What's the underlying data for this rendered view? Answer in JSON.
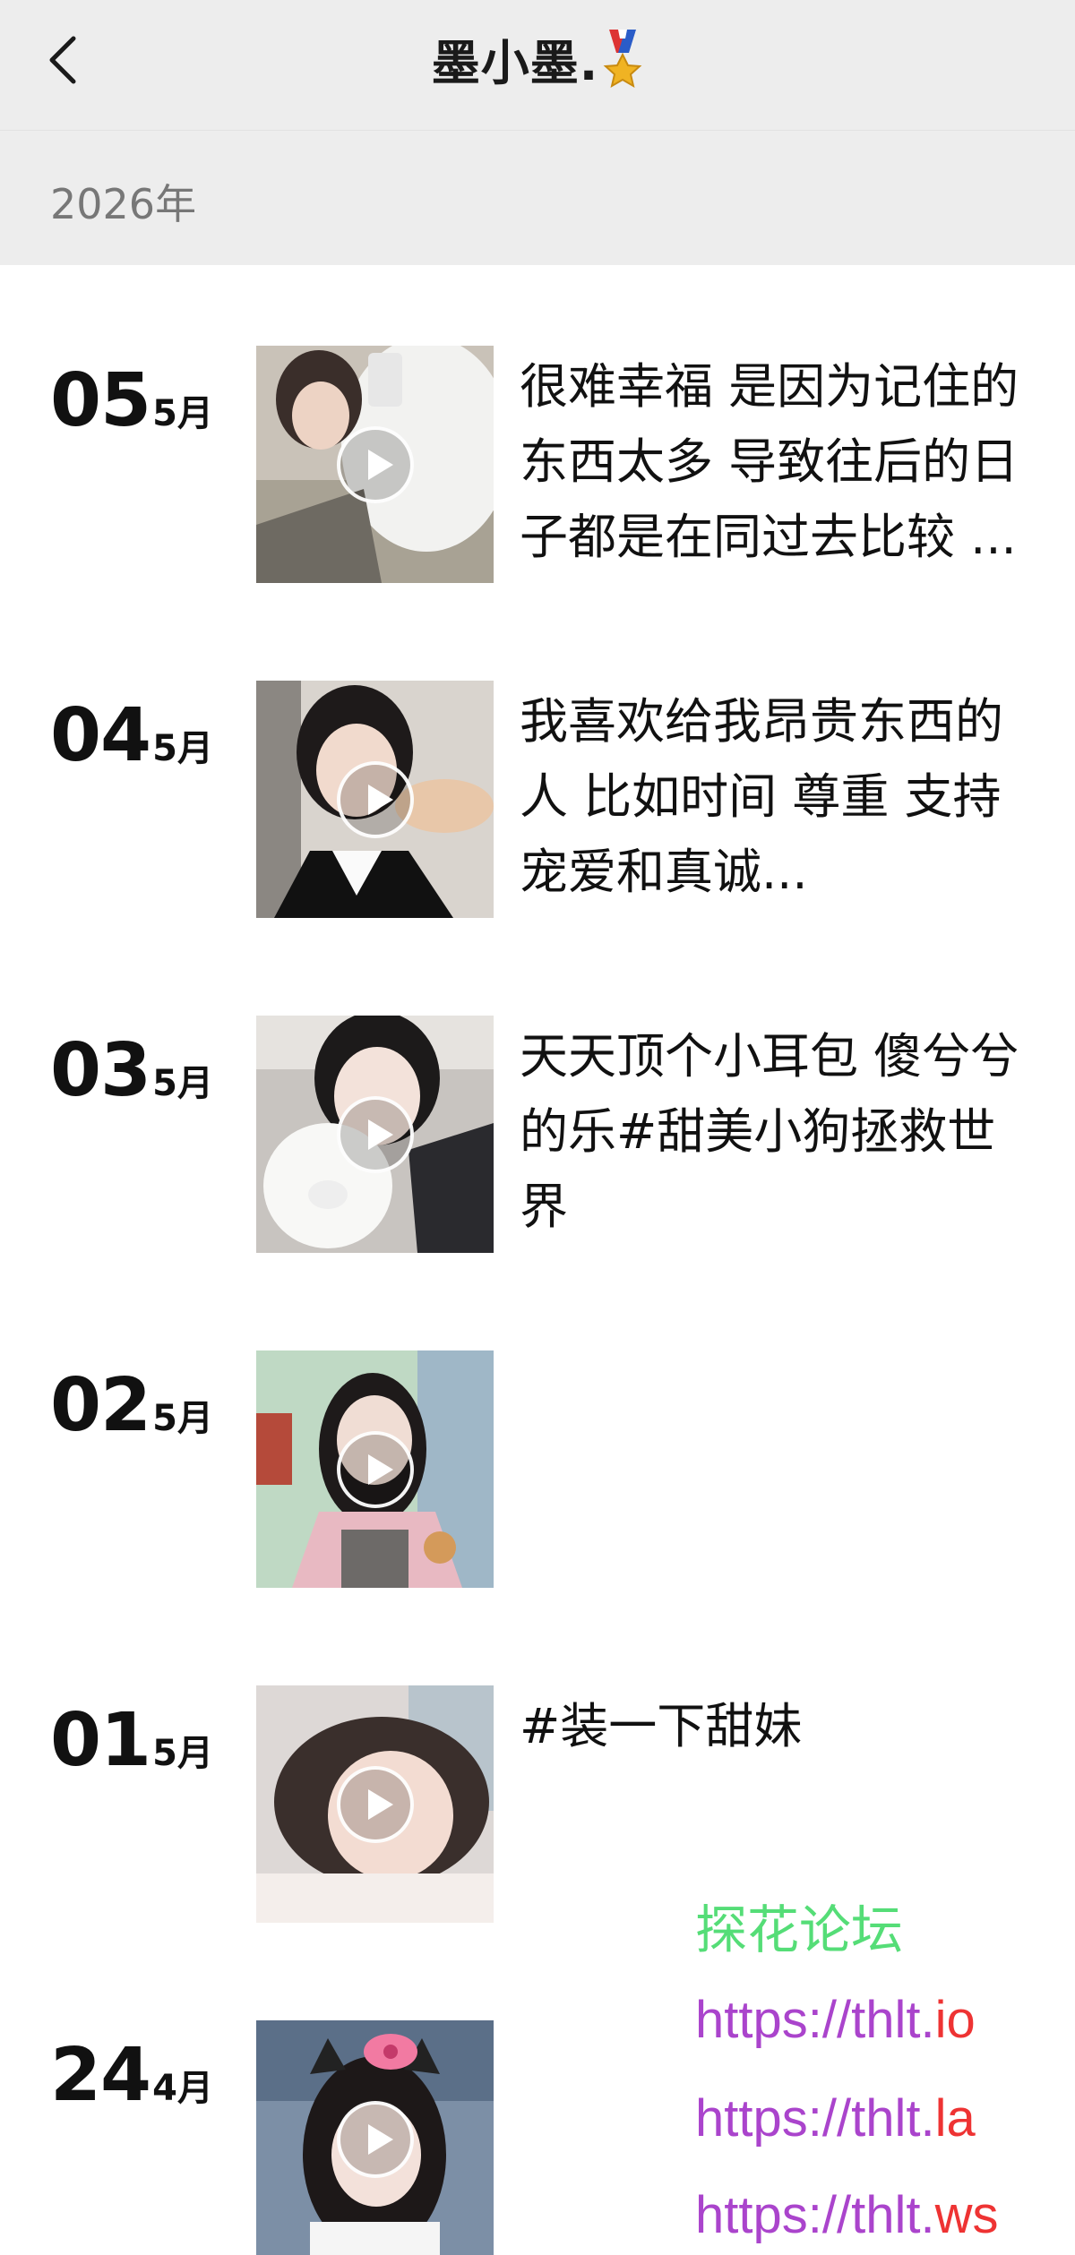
{
  "header": {
    "title": "墨小墨.",
    "back_icon": "chevron-left-icon",
    "title_badge_icon": "medal-icon"
  },
  "year_section": {
    "label": "2026年"
  },
  "posts": [
    {
      "day": "05",
      "month": "5月",
      "caption": "很难幸福 是因为记住的东西太多 导致往后的日子都是在同过去比较 ..."
    },
    {
      "day": "04",
      "month": "5月",
      "caption": "我喜欢给我昂贵东西的人 比如时间 尊重 支持宠爱和真诚..."
    },
    {
      "day": "03",
      "month": "5月",
      "caption": "天天顶个小耳包 傻兮兮的乐#甜美小狗拯救世界"
    },
    {
      "day": "02",
      "month": "5月",
      "caption": ""
    },
    {
      "day": "01",
      "month": "5月",
      "caption": "#装一下甜妹"
    },
    {
      "day": "24",
      "month": "4月",
      "caption": ""
    }
  ],
  "watermark": {
    "forum_name": "探花论坛",
    "links": [
      {
        "prefix": "https://thlt.",
        "suffix": "io"
      },
      {
        "prefix": "https://thlt.",
        "suffix": "la"
      },
      {
        "prefix": "https://thlt.",
        "suffix": "ws"
      }
    ]
  },
  "colors": {
    "nav_bg": "#ededed",
    "watermark_green": "#55dd77",
    "watermark_purple": "#aa44cc",
    "watermark_red": "#ee3333"
  }
}
